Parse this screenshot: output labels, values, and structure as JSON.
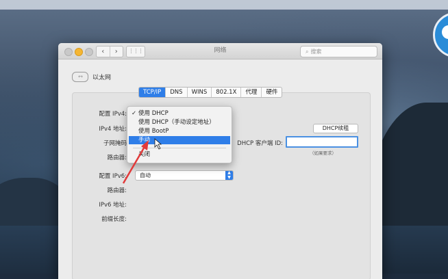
{
  "window": {
    "title": "网络",
    "search_placeholder": "搜索"
  },
  "interface": {
    "icon": "ethernet-icon",
    "name": "以太网"
  },
  "tabs": [
    {
      "label": "TCP/IP",
      "active": true
    },
    {
      "label": "DNS"
    },
    {
      "label": "WINS"
    },
    {
      "label": "802.1X"
    },
    {
      "label": "代理"
    },
    {
      "label": "硬件"
    }
  ],
  "ipv4": {
    "configure_label": "配置 IPv4:",
    "address_label": "IPv4 地址:",
    "subnet_label": "子网掩码",
    "router_label": "路由器:",
    "menu_options": [
      {
        "label": "使用 DHCP",
        "checked": true
      },
      {
        "label": "使用 DHCP（手动设定地址）"
      },
      {
        "label": "使用 BootP"
      },
      {
        "label": "手动",
        "highlighted": true
      },
      {
        "label": "关闭"
      }
    ],
    "renew_button": "DHCP续租",
    "client_id_label": "DHCP 客户端 ID:",
    "client_id_value": "",
    "client_id_note": "（如果要求）"
  },
  "ipv6": {
    "configure_label": "配置 IPv6:",
    "configure_value": "自动",
    "router_label": "路由器:",
    "address_label": "IPv6 地址:",
    "prefix_label": "前缀长度:"
  },
  "colors": {
    "accent": "#2f7ee8",
    "annotation_arrow": "#e23a3a"
  }
}
